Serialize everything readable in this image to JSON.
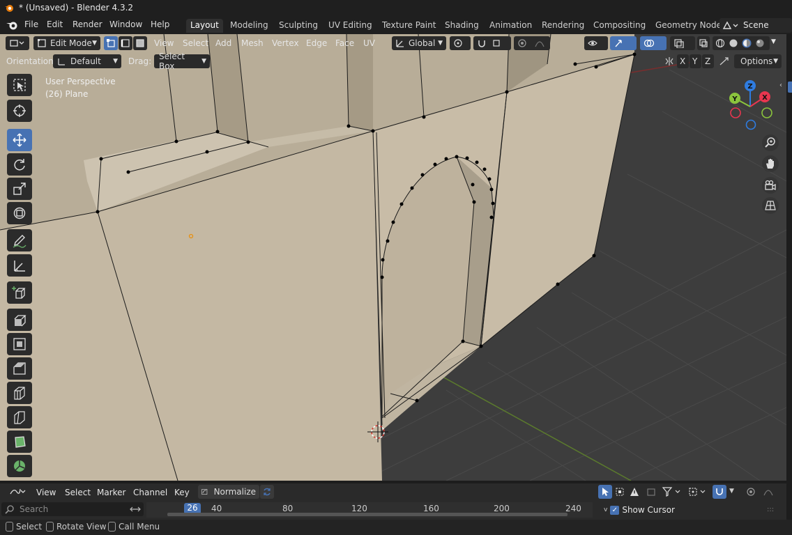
{
  "window": {
    "title": "* (Unsaved) - Blender 4.3.2"
  },
  "menubar": {
    "items": [
      "File",
      "Edit",
      "Render",
      "Window",
      "Help"
    ],
    "workspaces": [
      "Layout",
      "Modeling",
      "Sculpting",
      "UV Editing",
      "Texture Paint",
      "Shading",
      "Animation",
      "Rendering",
      "Compositing",
      "Geometry Node"
    ],
    "active_workspace": "Layout",
    "scene": "Scene"
  },
  "viewport_header": {
    "mode": "Edit Mode",
    "menus": [
      "View",
      "Select",
      "Add",
      "Mesh",
      "Vertex",
      "Edge",
      "Face",
      "UV"
    ],
    "transform_orientation": "Global",
    "orientation_label": "Orientation:",
    "orientation_value": "Default",
    "drag_label": "Drag:",
    "drag_value": "Select Box",
    "axes": [
      "X",
      "Y",
      "Z"
    ],
    "options": "Options"
  },
  "viewport": {
    "perspective": "User Perspective",
    "object": "(26) Plane",
    "gizmo": {
      "x": "X",
      "y": "Y",
      "z": "Z",
      "x_color": "#e8364f",
      "y_color": "#8bc53d",
      "z_color": "#2f7ce0"
    },
    "wall_color": "#c4b8a3",
    "floor_color": "#3d3d3d"
  },
  "timeline": {
    "menus": [
      "View",
      "Select",
      "Marker",
      "Channel",
      "Key"
    ],
    "normalize": "Normalize",
    "search_placeholder": "Search",
    "current_frame": "26",
    "ticks": [
      "40",
      "80",
      "120",
      "160",
      "200",
      "240"
    ],
    "show_cursor": "Show Cursor"
  },
  "statusbar": {
    "items": [
      "Select",
      "Rotate View",
      "Call Menu"
    ]
  },
  "colors": {
    "accent": "#4772b3"
  }
}
